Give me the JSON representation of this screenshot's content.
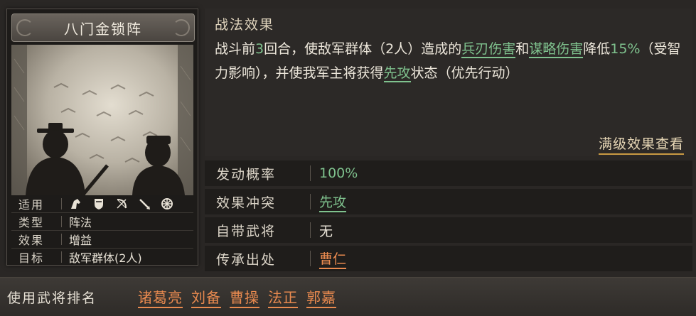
{
  "card": {
    "title": "八门金锁阵",
    "info": [
      {
        "key": "适用",
        "value": ""
      },
      {
        "key": "类型",
        "value": "阵法"
      },
      {
        "key": "效果",
        "value": "增益"
      },
      {
        "key": "目标",
        "value": "敌军群体(2人)"
      }
    ],
    "unit_icons": [
      "cavalry-icon",
      "shield-icon",
      "bow-icon",
      "spear-icon",
      "siege-wheel-icon"
    ]
  },
  "effect": {
    "heading": "战法效果",
    "parts": {
      "p1": "战斗前",
      "n1": "3",
      "p2": "回合，使敌军群体（2人）造成的",
      "k1": "兵刃伤害",
      "p3": "和",
      "k2": "谋略伤害",
      "p4": "降低",
      "n2": "15%",
      "p5": "（受智力影响），并使我军主将获得",
      "k3": "先攻",
      "p6": "状态（优先行动）"
    },
    "full_link": "满级效果查看"
  },
  "stats": [
    {
      "key": "发动概率",
      "value": "100%"
    },
    {
      "key": "效果冲突",
      "value": "先攻"
    },
    {
      "key": "自带武将",
      "value": "无"
    },
    {
      "key": "传承出处",
      "value": "曹仁"
    }
  ],
  "ranking": {
    "label": "使用武将排名",
    "generals": [
      "诸葛亮",
      "刘备",
      "曹操",
      "法正",
      "郭嘉"
    ]
  },
  "colors": {
    "green_highlight": "#7fc28e",
    "orange_link": "#e98a4f",
    "gold_underline": "#c99a43"
  }
}
